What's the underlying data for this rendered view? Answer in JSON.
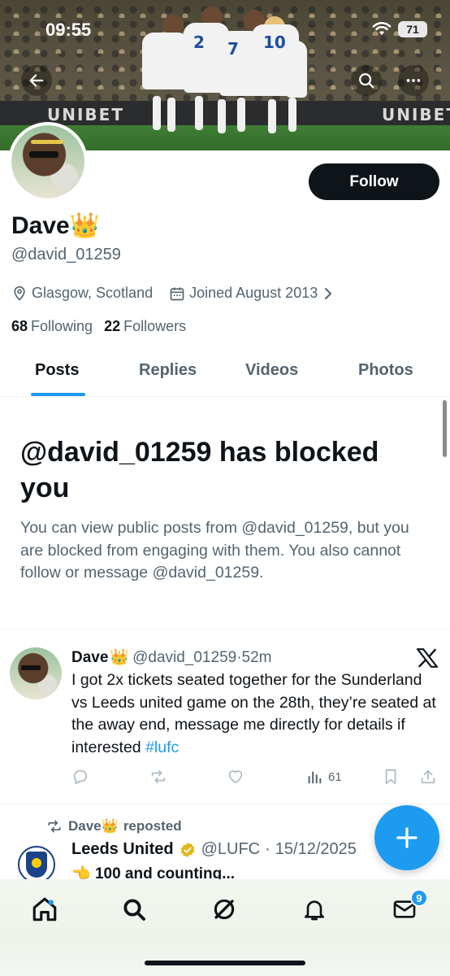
{
  "status_bar": {
    "time": "09:55",
    "battery": "71"
  },
  "profile": {
    "display_name": "Dave",
    "crown_emoji": "👑",
    "handle": "@david_01259",
    "location": "Glasgow, Scotland",
    "joined": "Joined August 2013",
    "following_count": "68",
    "following_label": "Following",
    "followers_count": "22",
    "followers_label": "Followers",
    "follow_button": "Follow"
  },
  "banner": {
    "board_text": "UNIBET"
  },
  "tabs": [
    {
      "label": "Posts",
      "active": true
    },
    {
      "label": "Replies",
      "active": false
    },
    {
      "label": "Videos",
      "active": false
    },
    {
      "label": "Photos",
      "active": false
    }
  ],
  "blocked_notice": {
    "title": "@david_01259 has blocked you",
    "description": "You can view public posts from @david_01259, but you are blocked from engaging with them. You also cannot follow or message @david_01259."
  },
  "post": {
    "author": "Dave",
    "handle": "@david_01259",
    "separator": "·",
    "time": "52m",
    "text": "I got 2x tickets seated together for the Sunderland vs Leeds united game on the 28th, they’re seated at the away end, message me directly for details if interested",
    "hashtag": "#lufc",
    "views": "61"
  },
  "repost": {
    "reposter": "Dave",
    "reposted_label": "reposted",
    "author": "Leeds United",
    "handle": "@LUFC",
    "date": "15/12/2025",
    "text": "100 and counting..."
  },
  "bottom_nav": {
    "messages_badge": "9"
  },
  "colors": {
    "accent": "#1d9bf0",
    "text": "#0f1419",
    "secondary": "#536471"
  },
  "icons": [
    "back-arrow-icon",
    "search-icon",
    "more-icon",
    "location-pin-icon",
    "calendar-icon",
    "chevron-right-icon",
    "x-logo-icon",
    "reply-icon",
    "repost-icon",
    "like-icon",
    "views-icon",
    "bookmark-icon",
    "share-icon",
    "plus-icon",
    "home-icon",
    "grok-icon",
    "bell-icon",
    "mail-icon"
  ]
}
